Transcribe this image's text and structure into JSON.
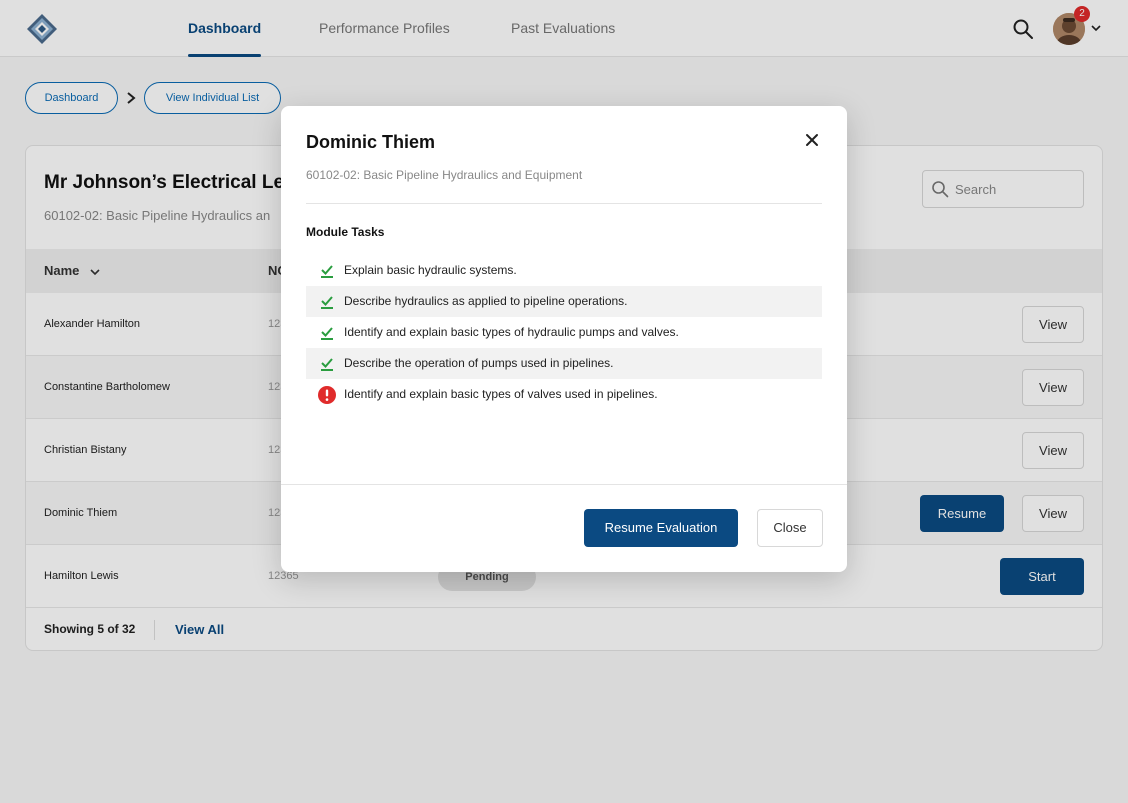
{
  "nav": {
    "logo": "app-logo",
    "tabs": [
      {
        "label": "Dashboard",
        "active": true
      },
      {
        "label": "Performance Profiles",
        "active": false
      },
      {
        "label": "Past Evaluations",
        "active": false
      }
    ],
    "notification_count": "2"
  },
  "breadcrumb": {
    "items": [
      "Dashboard",
      "View Individual List"
    ]
  },
  "card": {
    "title": "Mr Johnson’s Electrical Level",
    "subtitle": "60102-02: Basic Pipeline Hydraulics an",
    "search_placeholder": "Search",
    "columns": {
      "name": "Name",
      "no": "NO"
    },
    "rows": [
      {
        "name": "Alexander Hamilton",
        "no": "123",
        "status": "",
        "action": "",
        "view": "View"
      },
      {
        "name": "Constantine Bartholomew",
        "no": "123",
        "status": "",
        "action": "",
        "view": "View"
      },
      {
        "name": "Christian Bistany",
        "no": "123",
        "status": "",
        "action": "",
        "view": "View"
      },
      {
        "name": "Dominic Thiem",
        "no": "123",
        "status": "",
        "action": "Resume",
        "view": "View"
      },
      {
        "name": "Hamilton Lewis",
        "no": "12365",
        "status": "Pending",
        "action": "Start",
        "view": ""
      }
    ],
    "footer": {
      "showing": "Showing 5 of 32",
      "view_all": "View All"
    }
  },
  "modal": {
    "title": "Dominic Thiem",
    "subtitle": "60102-02: Basic Pipeline Hydraulics and Equipment",
    "section_title": "Module Tasks",
    "tasks": [
      {
        "text": "Explain basic hydraulic systems.",
        "status": "complete"
      },
      {
        "text": "Describe hydraulics as applied to pipeline operations.",
        "status": "complete"
      },
      {
        "text": "Identify and explain basic types of hydraulic pumps and valves.",
        "status": "complete"
      },
      {
        "text": "Describe the operation of pumps used in pipelines.",
        "status": "complete"
      },
      {
        "text": "Identify and explain basic types of valves used in pipelines.",
        "status": "incomplete"
      }
    ],
    "primary_button": "Resume Evaluation",
    "secondary_button": "Close"
  },
  "colors": {
    "brand": "#0b4a82",
    "link": "#0b6bb5",
    "check": "#2a9d3f",
    "alert": "#e02b2b"
  }
}
